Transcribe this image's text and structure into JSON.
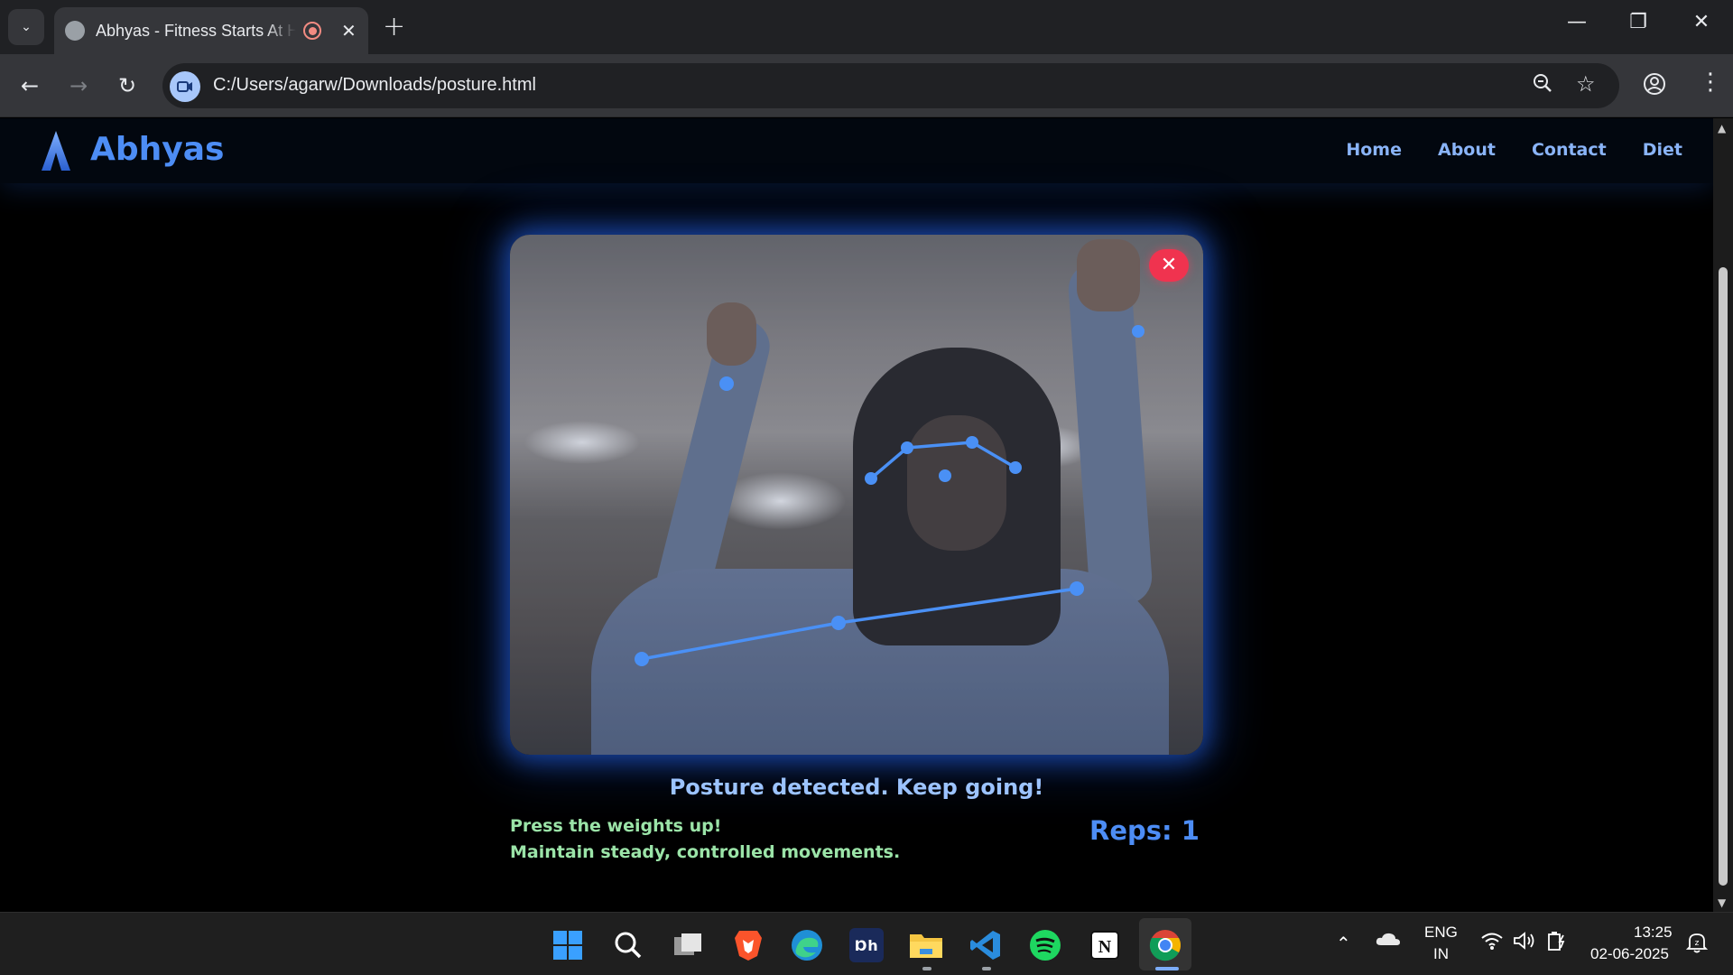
{
  "browser": {
    "tab_title": "Abhyas - Fitness Starts At Home",
    "tab_close": "✕",
    "new_tab": "+",
    "url": "C:/Users/agarw/Downloads/posture.html",
    "window_controls": {
      "minimize": "—",
      "restore": "❐",
      "close": "✕"
    }
  },
  "site": {
    "logo_text": "Abhyas",
    "nav": [
      "Home",
      "About",
      "Contact",
      "Diet"
    ]
  },
  "workout": {
    "close_label": "✕",
    "status": "Posture detected. Keep going!",
    "instruction_1": "Press the weights up!",
    "instruction_2": "Maintain steady, controlled movements.",
    "reps": "Reps: 1"
  },
  "taskbar": {
    "lang_1": "ENG",
    "lang_2": "IN",
    "time": "13:25",
    "date": "02-06-2025",
    "apps": [
      "windows-start",
      "search",
      "task-view",
      "brave",
      "edge",
      "dh",
      "file-explorer",
      "vscode",
      "spotify",
      "notion",
      "chrome"
    ]
  },
  "colors": {
    "accent": "#4d8df5",
    "status": "#9cc3ff",
    "instruction": "#9be4a8",
    "close": "#f0334f",
    "pose_line": "#4a90f5"
  }
}
